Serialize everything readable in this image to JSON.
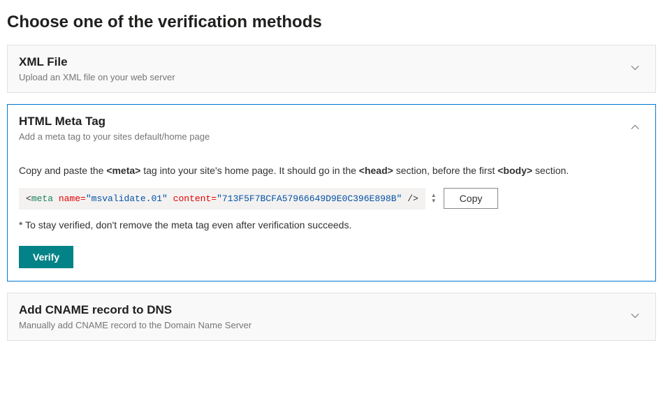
{
  "page": {
    "heading": "Choose one of the verification methods"
  },
  "methods": {
    "xml": {
      "title": "XML File",
      "subtitle": "Upload an XML file on your web server"
    },
    "meta": {
      "title": "HTML Meta Tag",
      "subtitle": "Add a meta tag to your sites default/home page",
      "instruction_pre": "Copy and paste the ",
      "instruction_tag1": "<meta>",
      "instruction_mid1": " tag into your site's home page. It should go in the ",
      "instruction_tag2": "<head>",
      "instruction_mid2": " section, before the first ",
      "instruction_tag3": "<body>",
      "instruction_post": " section.",
      "code": {
        "open_bracket": "<",
        "tag": "meta",
        "attr1_name": " name=",
        "attr1_val": "\"msvalidate.01\"",
        "attr2_name": " content=",
        "attr2_val": "\"713F5F7BCFA57966649D9E0C396E898B\"",
        "close": " />"
      },
      "copy_label": "Copy",
      "note": "* To stay verified, don't remove the meta tag even after verification succeeds.",
      "verify_label": "Verify"
    },
    "cname": {
      "title": "Add CNAME record to DNS",
      "subtitle": "Manually add CNAME record to the Domain Name Server"
    }
  }
}
